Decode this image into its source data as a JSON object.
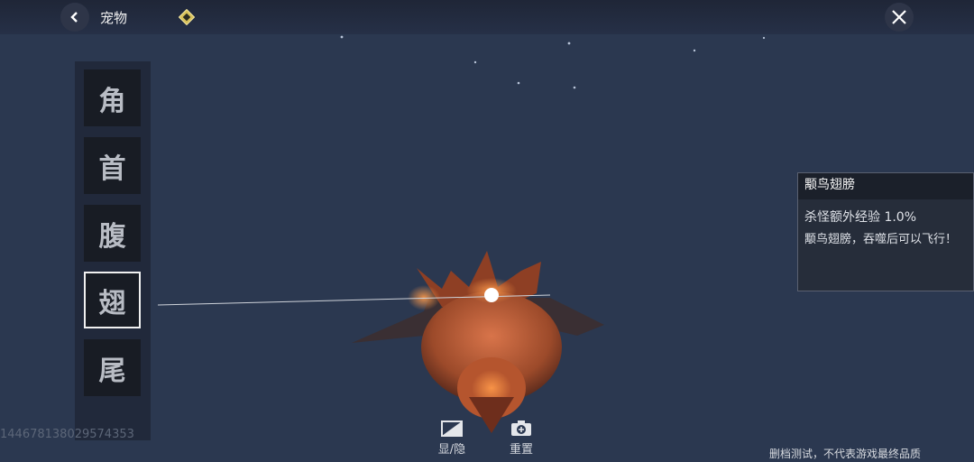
{
  "header": {
    "title": "宠物"
  },
  "parts": [
    {
      "label": "角",
      "active": false
    },
    {
      "label": "首",
      "active": false
    },
    {
      "label": "腹",
      "active": false
    },
    {
      "label": "翅",
      "active": true
    },
    {
      "label": "尾",
      "active": false
    }
  ],
  "info_panel": {
    "title": "颙鸟翅膀",
    "bonus": "杀怪额外经验 1.0%",
    "description": "颙鸟翅膀，吞噬后可以飞行！"
  },
  "player_id": "1446781380295743​53",
  "toolbar": {
    "toggle_label": "显/隐",
    "reset_label": "重置"
  },
  "disclaimer": "删档测试，不代表游戏最终品质",
  "colors": {
    "sky": "#2b3850",
    "creature": "#c0613a",
    "accent_gold": "#d8c25a"
  }
}
